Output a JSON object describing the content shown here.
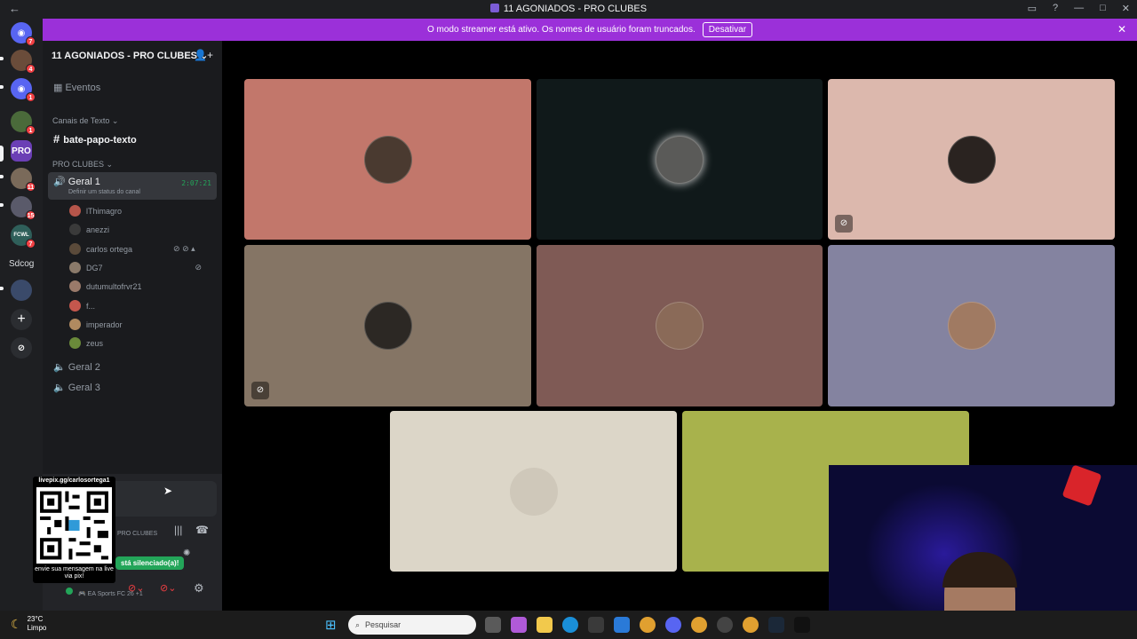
{
  "window": {
    "title": "11 AGONIADOS - PRO CLUBES"
  },
  "banner": {
    "text": "O modo streamer está ativo. Os nomes de usuário foram truncados.",
    "button": "Desativar"
  },
  "rail": {
    "badges": [
      "7",
      "4",
      "1",
      "1",
      "11",
      "15",
      "7"
    ],
    "text_server": "Sdcog"
  },
  "sidebar": {
    "server_name": "11 AGONIADOS - PRO CLUBES",
    "events": "Eventos",
    "text_category": "Canais de Texto",
    "text_channel": "bate-papo-texto",
    "voice_category": "PRO CLUBES",
    "active_channel": "Geral 1",
    "active_channel_status": "Definir um status do canal",
    "timer": "2:07:21",
    "members": [
      "lThimagro",
      "anezzi",
      "carlos ortega",
      "DG7",
      "dutumultofrvr21",
      "f...",
      "imperador",
      "zeus"
    ],
    "voice_channels": [
      "Geral 2",
      "Geral 3"
    ]
  },
  "panel": {
    "qr_label": "livepix.gg/carlosortega1",
    "qr_footer": "envie sua mensagem na live via pix!",
    "voice_label": "PRO CLUBES",
    "muted_text": "stá silenciado(a)!",
    "activity": "EA Sports FC 26 +1"
  },
  "taskbar": {
    "temperature": "23°C",
    "condition": "Limpo",
    "search_placeholder": "Pesquisar"
  },
  "colors": {
    "tile1": "#c2776b",
    "tile2": "#10191a",
    "tile3": "#dcb8ad",
    "tile4": "#857565",
    "tile5": "#7f5a55",
    "tile6": "#8483a0",
    "tile7": "#dcd6c8",
    "tile8": "#a8b24c",
    "banner": "#9b30d9",
    "speaking": "#23a559"
  }
}
